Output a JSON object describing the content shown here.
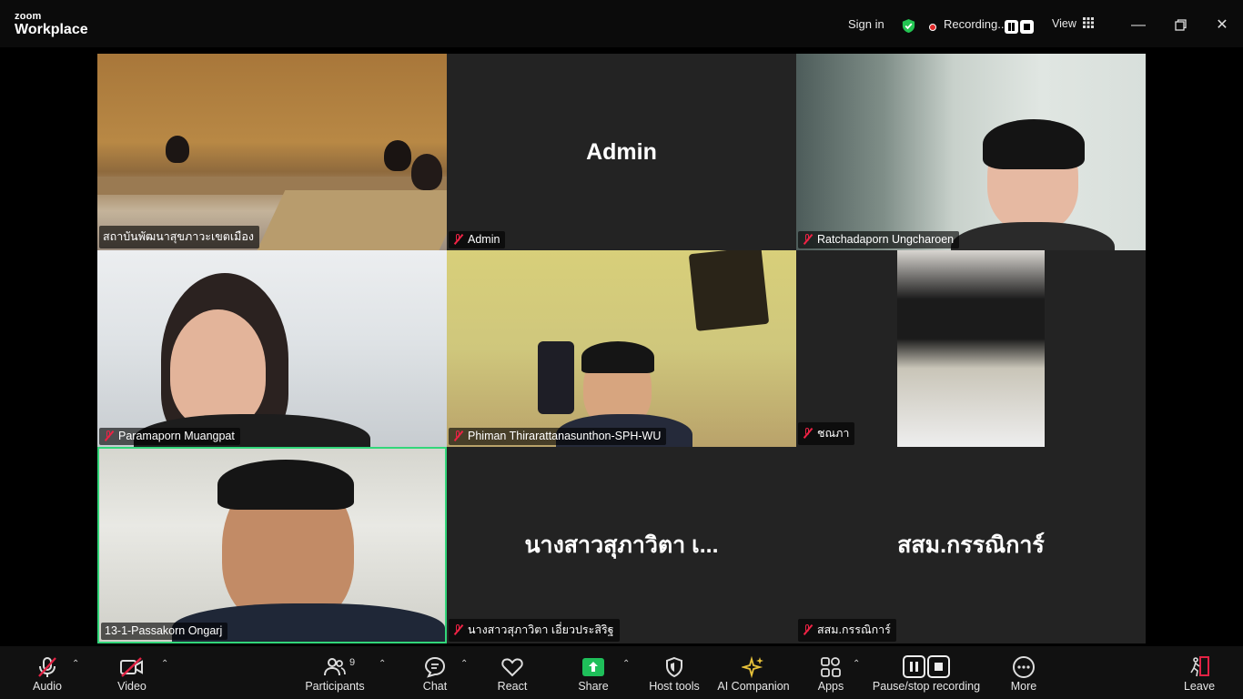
{
  "titlebar": {
    "logo_top": "zoom",
    "logo_bottom": "Workplace",
    "sign_in": "Sign in",
    "recording": "Recording...",
    "view": "View",
    "icons": [
      "shield-check-icon",
      "record-dot-icon",
      "pause-icon",
      "stop-icon",
      "grid-icon",
      "minimize-icon",
      "restore-icon",
      "close-icon"
    ]
  },
  "tiles": [
    {
      "name": "สถาบันพัฒนาสุขภาวะเขตเมือง",
      "muted": false,
      "video": true
    },
    {
      "name": "Admin",
      "display": "Admin",
      "muted": true,
      "video": false
    },
    {
      "name": "Ratchadaporn Ungcharoen",
      "muted": true,
      "video": true
    },
    {
      "name": "Paramaporn Muangpat",
      "muted": true,
      "video": true
    },
    {
      "name": "Phiman Thirarattanasunthon-SPH-WU",
      "muted": true,
      "video": true
    },
    {
      "name": "ชณภา",
      "muted": true,
      "video": true
    },
    {
      "name": "13-1-Passakorn Ongarj",
      "muted": false,
      "video": true,
      "active_speaker": true
    },
    {
      "name": "นางสาวสุภาวิตา เอี่ยวประสิริฐ",
      "display": "นางสาวสุภาวิตา เ...",
      "muted": true,
      "video": false
    },
    {
      "name": "สสม.กรรณิการ์",
      "display": "สสม.กรรณิการ์",
      "muted": true,
      "video": false
    }
  ],
  "toolbar": {
    "audio": "Audio",
    "video": "Video",
    "participants": "Participants",
    "participants_count": "9",
    "chat": "Chat",
    "react": "React",
    "share": "Share",
    "host_tools": "Host tools",
    "ai_companion": "AI Companion",
    "apps": "Apps",
    "pause_stop": "Pause/stop recording",
    "more": "More",
    "leave": "Leave"
  },
  "colors": {
    "background": "#000000",
    "tile": "#232323",
    "active_speaker": "#32d67a",
    "share_green": "#1fbf5a",
    "muted_red": "#e22244"
  }
}
